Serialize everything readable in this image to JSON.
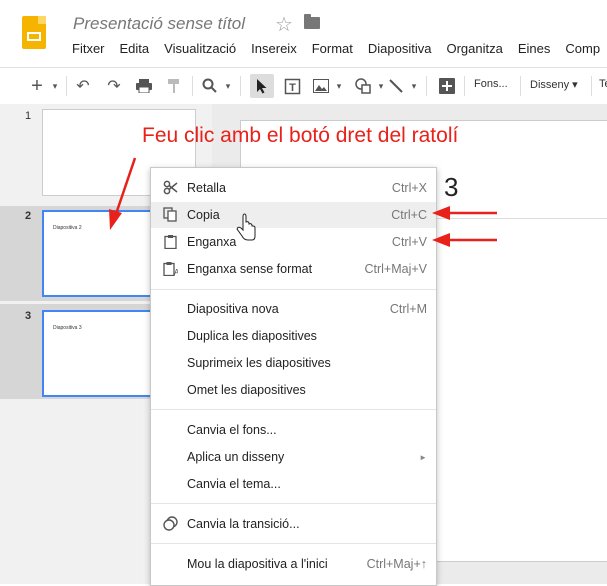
{
  "app": {
    "doc_title": "Presentació sense títol",
    "menu": [
      "Fitxer",
      "Edita",
      "Visualització",
      "Insereix",
      "Format",
      "Diapositiva",
      "Organitza",
      "Eines",
      "Comp"
    ]
  },
  "toolbar": {
    "background_label": "Fons...",
    "layout_label": "Disseny ▾",
    "theme_label": "Tem"
  },
  "slides": [
    {
      "number": "1",
      "title": ""
    },
    {
      "number": "2",
      "title": "Diapositiva 2"
    },
    {
      "number": "3",
      "title": "Diapositiva 3"
    }
  ],
  "canvas": {
    "slide_number_text": "3"
  },
  "annotation": {
    "text": "Feu clic amb el botó dret del ratolí",
    "color": "#e8211a"
  },
  "context_menu": {
    "items": [
      {
        "icon": "scissors-icon",
        "label": "Retalla",
        "shortcut": "Ctrl+X"
      },
      {
        "icon": "copy-icon",
        "label": "Copia",
        "shortcut": "Ctrl+C"
      },
      {
        "icon": "clipboard-icon",
        "label": "Enganxa",
        "shortcut": "Ctrl+V"
      },
      {
        "icon": "paste-plain-icon",
        "label": "Enganxa sense format",
        "shortcut": "Ctrl+Maj+V"
      },
      {
        "label": "Diapositiva nova",
        "shortcut": "Ctrl+M"
      },
      {
        "label": "Duplica les diapositives",
        "shortcut": ""
      },
      {
        "label": "Suprimeix les diapositives",
        "shortcut": ""
      },
      {
        "label": "Omet les diapositives",
        "shortcut": ""
      },
      {
        "label": "Canvia el fons...",
        "shortcut": ""
      },
      {
        "label": "Aplica un disseny",
        "shortcut": "►"
      },
      {
        "label": "Canvia el tema...",
        "shortcut": ""
      },
      {
        "icon": "transition-icon",
        "label": "Canvia la transició...",
        "shortcut": ""
      },
      {
        "label": "Mou la diapositiva a l'inici",
        "shortcut": "Ctrl+Maj+↑"
      }
    ]
  },
  "colors": {
    "accent_blue": "#4285f4",
    "slides_yellow": "#f4b400"
  }
}
